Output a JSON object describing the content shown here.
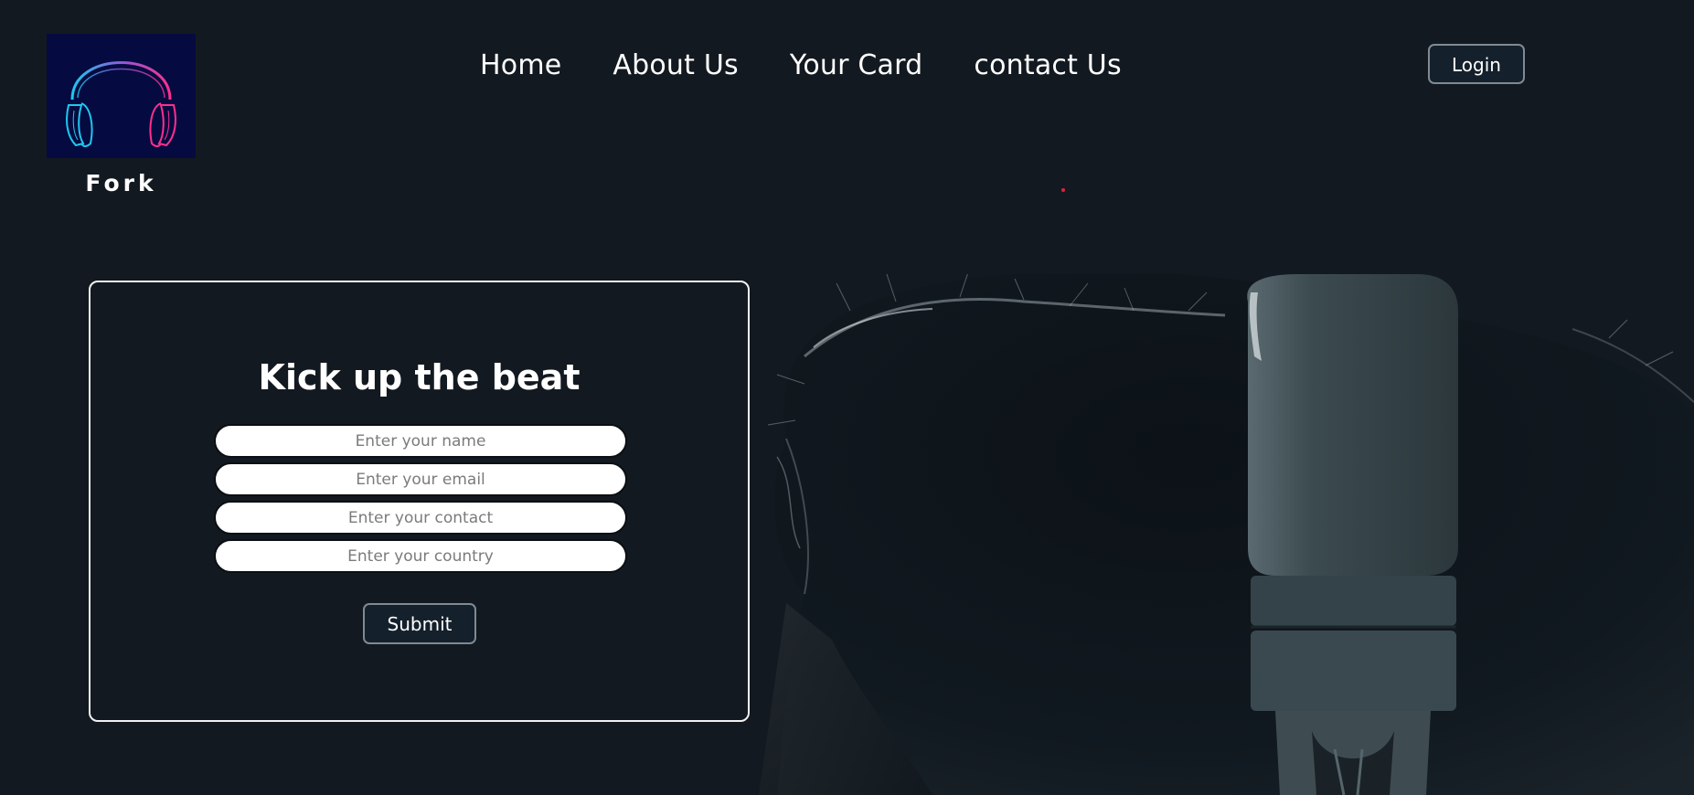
{
  "brand": {
    "name": "Fork",
    "logo_icon": "headphones-icon",
    "logo_colors": {
      "background": "#050b40",
      "left": "#1ec8f0",
      "right": "#ff2f8e"
    }
  },
  "nav": {
    "items": [
      {
        "label": "Home"
      },
      {
        "label": "About Us"
      },
      {
        "label": "Your Card"
      },
      {
        "label": "contact Us"
      }
    ],
    "login_label": "Login"
  },
  "form": {
    "title": "Kick up the beat",
    "fields": [
      {
        "name": "name",
        "placeholder": "Enter your name",
        "value": ""
      },
      {
        "name": "email",
        "placeholder": "Enter your email",
        "value": ""
      },
      {
        "name": "contact",
        "placeholder": "Enter your contact",
        "value": ""
      },
      {
        "name": "country",
        "placeholder": "Enter your country",
        "value": ""
      }
    ],
    "submit_label": "Submit"
  },
  "theme": {
    "background": "#131920",
    "accent_dot": "#e0233a",
    "text": "#ffffff"
  }
}
